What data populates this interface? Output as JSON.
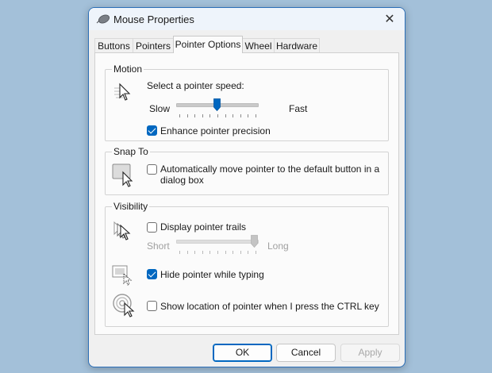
{
  "window": {
    "title": "Mouse Properties",
    "close_glyph": "✕"
  },
  "tabs": [
    {
      "label": "Buttons",
      "active": false
    },
    {
      "label": "Pointers",
      "active": false
    },
    {
      "label": "Pointer Options",
      "active": true
    },
    {
      "label": "Wheel",
      "active": false
    },
    {
      "label": "Hardware",
      "active": false
    }
  ],
  "motion": {
    "legend": "Motion",
    "speed_label": "Select a pointer speed:",
    "slow_label": "Slow",
    "fast_label": "Fast",
    "speed_value": 0.5,
    "precision_label": "Enhance pointer precision",
    "precision_checked": true
  },
  "snap": {
    "legend": "Snap To",
    "auto_move_label_line1": "Automatically move pointer to the default button in a",
    "auto_move_label_line2": "dialog box",
    "auto_move_checked": false
  },
  "visibility": {
    "legend": "Visibility",
    "trails_label": "Display pointer trails",
    "trails_checked": false,
    "short_label": "Short",
    "long_label": "Long",
    "trails_value": 1.0,
    "hide_label": "Hide pointer while typing",
    "hide_checked": true,
    "ctrl_label": "Show location of pointer when I press the CTRL key",
    "ctrl_checked": false
  },
  "buttons": {
    "ok": "OK",
    "cancel": "Cancel",
    "apply": "Apply"
  },
  "colors": {
    "accent": "#0067c0",
    "desktop": "#a3c0d9",
    "window_border": "#2b6fb8"
  }
}
